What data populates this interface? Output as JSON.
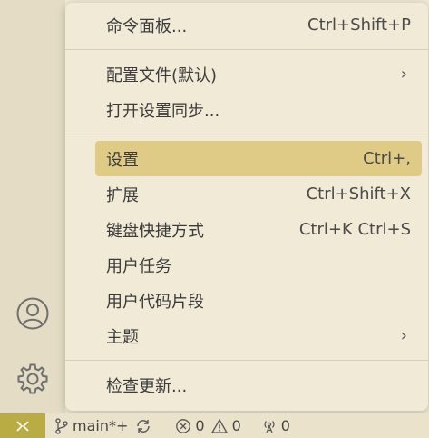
{
  "menu": {
    "items": [
      {
        "label": "命令面板...",
        "shortcut": "Ctrl+Shift+P",
        "submenu": false,
        "selected": false
      },
      {
        "label": "配置文件(默认)",
        "shortcut": "",
        "submenu": true,
        "selected": false
      },
      {
        "label": "打开设置同步...",
        "shortcut": "",
        "submenu": false,
        "selected": false
      },
      {
        "label": "设置",
        "shortcut": "Ctrl+,",
        "submenu": false,
        "selected": true
      },
      {
        "label": "扩展",
        "shortcut": "Ctrl+Shift+X",
        "submenu": false,
        "selected": false
      },
      {
        "label": "键盘快捷方式",
        "shortcut": "Ctrl+K Ctrl+S",
        "submenu": false,
        "selected": false
      },
      {
        "label": "用户任务",
        "shortcut": "",
        "submenu": false,
        "selected": false
      },
      {
        "label": "用户代码片段",
        "shortcut": "",
        "submenu": false,
        "selected": false
      },
      {
        "label": "主题",
        "shortcut": "",
        "submenu": true,
        "selected": false
      },
      {
        "label": "检查更新...",
        "shortcut": "",
        "submenu": false,
        "selected": false
      }
    ],
    "submenu_glyph": "›"
  },
  "activity_bar": {
    "accounts_icon": "account-icon",
    "manage_icon": "gear-icon"
  },
  "statusbar": {
    "remote_icon": "remote-icon",
    "branch": "main*+",
    "errors": "0",
    "warnings": "0",
    "ports": "0"
  },
  "colors": {
    "menu_bg": "#f1ead7",
    "selected_bg": "#e0cb86",
    "remote_bg": "#b9ac45"
  }
}
